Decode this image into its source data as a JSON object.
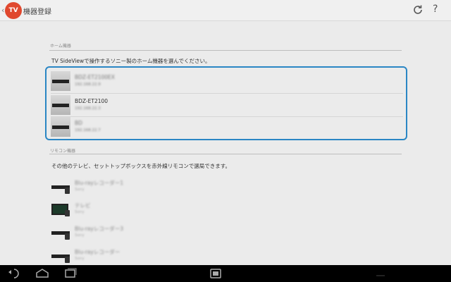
{
  "header": {
    "back_glyph": "‹",
    "app_icon_text": "TV",
    "title": "機器登録",
    "help_glyph": "?"
  },
  "home_section": {
    "heading": "ホーム機器",
    "description": "TV SideViewで操作するソニー製のホーム機器を選んでください。",
    "devices": [
      {
        "name": "BDZ-ET2100EX",
        "address": "192.168.22.9",
        "obscured": true
      },
      {
        "name": "BDZ-ET2100",
        "address": "192.168.22.3",
        "obscured": false
      },
      {
        "name": "BD",
        "address": "192.168.22.7",
        "obscured": true
      }
    ]
  },
  "remote_section": {
    "heading": "リモコン機器",
    "description": "その他のテレビ、セットトップボックスを赤外線リモコンで選局できます。",
    "devices": [
      {
        "name": "Blu-rayレコーダー1",
        "maker": "Sony",
        "type": "recorder"
      },
      {
        "name": "テレビ",
        "maker": "Sony",
        "type": "tv"
      },
      {
        "name": "Blu-rayレコーダー3",
        "maker": "Sony",
        "type": "recorder"
      },
      {
        "name": "Blu-rayレコーダー",
        "maker": "Sony",
        "type": "recorder"
      }
    ]
  },
  "colors": {
    "accent": "#2a86c4",
    "brand": "#e0482e",
    "nav_bar": "#000000"
  }
}
